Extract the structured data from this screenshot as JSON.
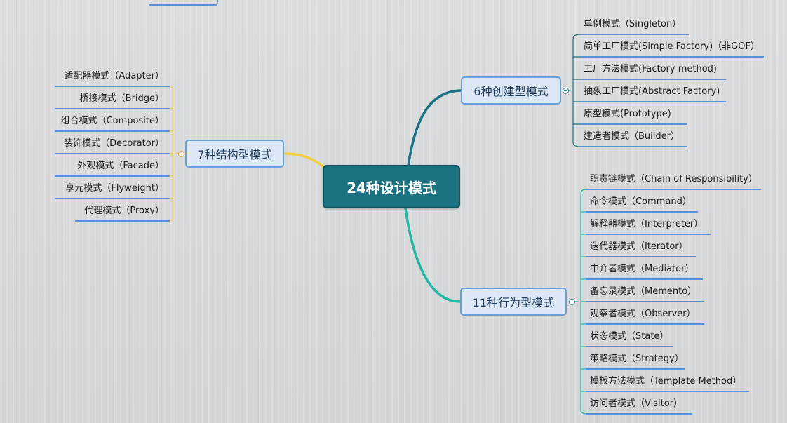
{
  "central": {
    "title": "24种设计模式"
  },
  "branches": {
    "creational": {
      "title": "6种创建型模式",
      "items": [
        "单例模式（Singleton）",
        "简单工厂模式(Simple Factory)（非GOF）",
        "工厂方法模式(Factory method)",
        "抽象工厂模式(Abstract Factory)",
        "原型模式(Prototype)",
        "建造者模式（Builder）"
      ]
    },
    "structural": {
      "title": "7种结构型模式",
      "items": [
        "适配器模式（Adapter）",
        "桥接模式（Bridge）",
        "组合模式（Composite）",
        "装饰模式（Decorator）",
        "外观模式（Facade）",
        "享元模式（Flyweight）",
        "代理模式（Proxy）"
      ]
    },
    "behavioral": {
      "title": "11种行为型模式",
      "items": [
        "职责链模式（Chain of Responsibility）",
        "命令模式（Command）",
        "解释器模式（Interpreter）",
        "迭代器模式（Iterator）",
        "中介者模式（Mediator）",
        "备忘录模式（Memento）",
        "观察者模式（Observer）",
        "状态模式（State）",
        "策略模式（Strategy）",
        "模板方法模式（Template Method）",
        "访问者模式（Visitor）"
      ]
    }
  },
  "colors": {
    "central_fill": "#1b7180",
    "creational_link": "#1a7285",
    "structural_link": "#f2cf3a",
    "behavioral_link": "#22b7a3",
    "leaf_underline": "#5b8fd6",
    "branch_border": "#6a9fd8"
  }
}
